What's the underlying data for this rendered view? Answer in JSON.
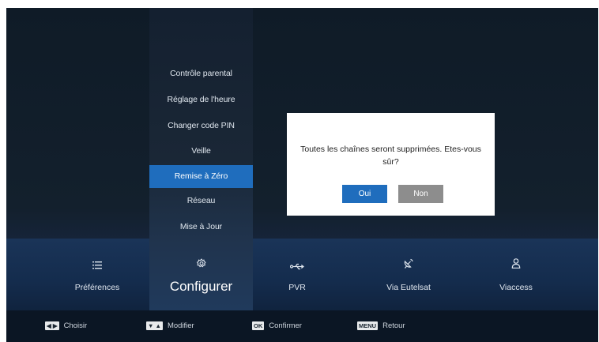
{
  "menu": {
    "items": [
      {
        "label": "Contrôle parental"
      },
      {
        "label": "Réglage de l'heure"
      },
      {
        "label": "Changer code PIN"
      },
      {
        "label": "Veille"
      },
      {
        "label": "Remise à Zéro",
        "selected": true
      },
      {
        "label": "Réseau"
      },
      {
        "label": "Mise à Jour"
      }
    ]
  },
  "tabs": [
    {
      "label": "Préférences",
      "icon": "list-icon"
    },
    {
      "label": "Configurer",
      "icon": "gear-icon",
      "active": true
    },
    {
      "label": "PVR",
      "icon": "usb-icon"
    },
    {
      "label": "Via Eutelsat",
      "icon": "satellite-dish-icon"
    },
    {
      "label": "Viaccess",
      "icon": "user-icon"
    }
  ],
  "dialog": {
    "message": "Toutes les chaînes seront supprimées. Etes-vous sûr?",
    "yes_label": "Oui",
    "no_label": "Non"
  },
  "hints": [
    {
      "key": "◀ ▶",
      "label": "Choisir"
    },
    {
      "key": "▼ ▲",
      "label": "Modifier"
    },
    {
      "key": "OK",
      "label": "Confirmer"
    },
    {
      "key": "MENU",
      "label": "Retour"
    }
  ],
  "colors": {
    "accent": "#1f6dbd",
    "background": "#13202d",
    "dialog_no_button": "#8d8d8d"
  }
}
